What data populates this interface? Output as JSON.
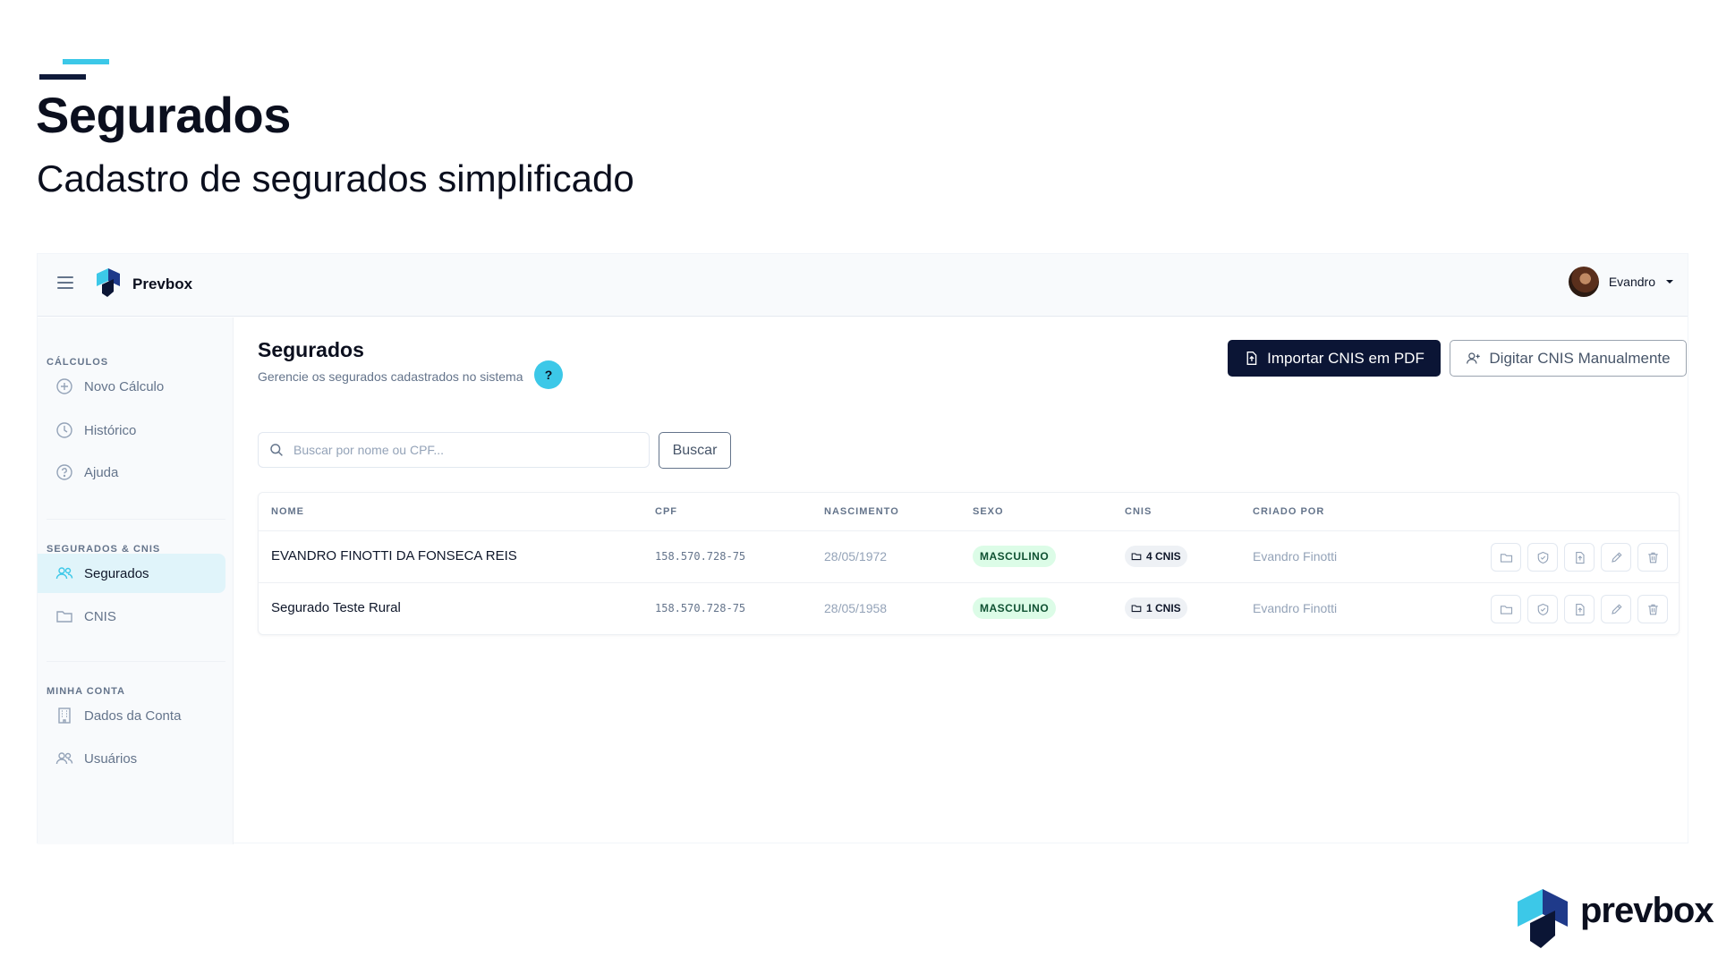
{
  "slide": {
    "title": "Segurados",
    "subtitle": "Cadastro de segurados simplificado",
    "footer_brand": "prevbox"
  },
  "colors": {
    "accent": "#3cc8e8",
    "navy": "#0b1535",
    "badge_green": "#dcfce7"
  },
  "topbar": {
    "brand": "Prevbox",
    "user_name": "Evandro"
  },
  "sidebar": {
    "sections": [
      {
        "label": "CÁLCULOS",
        "items": [
          {
            "label": "Novo Cálculo",
            "icon": "plus-circle-icon"
          },
          {
            "label": "Histórico",
            "icon": "clock-icon"
          },
          {
            "label": "Ajuda",
            "icon": "help-circle-icon"
          }
        ]
      },
      {
        "label": "SEGURADOS & CNIS",
        "items": [
          {
            "label": "Segurados",
            "icon": "users-icon",
            "active": true
          },
          {
            "label": "CNIS",
            "icon": "folder-icon"
          }
        ]
      },
      {
        "label": "MINHA CONTA",
        "items": [
          {
            "label": "Dados da Conta",
            "icon": "building-icon"
          },
          {
            "label": "Usuários",
            "icon": "users-icon"
          }
        ]
      }
    ]
  },
  "main": {
    "title": "Segurados",
    "description": "Gerencie os segurados cadastrados no sistema",
    "help": "?",
    "import_button": "Importar CNIS em PDF",
    "manual_button": "Digitar CNIS Manualmente",
    "search_placeholder": "Buscar por nome ou CPF...",
    "search_value": "",
    "search_button": "Buscar"
  },
  "table": {
    "columns": [
      "NOME",
      "CPF",
      "NASCIMENTO",
      "SEXO",
      "CNIS",
      "CRIADO POR"
    ],
    "rows": [
      {
        "nome": "EVANDRO FINOTTI DA FONSECA REIS",
        "cpf": "158.570.728-75",
        "nascimento": "28/05/1972",
        "sexo": "MASCULINO",
        "cnis": "4 CNIS",
        "criado_por": "Evandro Finotti"
      },
      {
        "nome": "Segurado Teste Rural",
        "cpf": "158.570.728-75",
        "nascimento": "28/05/1958",
        "sexo": "MASCULINO",
        "cnis": "1 CNIS",
        "criado_por": "Evandro Finotti"
      }
    ],
    "row_actions": [
      "folder-icon",
      "shield-icon",
      "file-upload-icon",
      "pencil-icon",
      "trash-icon"
    ]
  }
}
